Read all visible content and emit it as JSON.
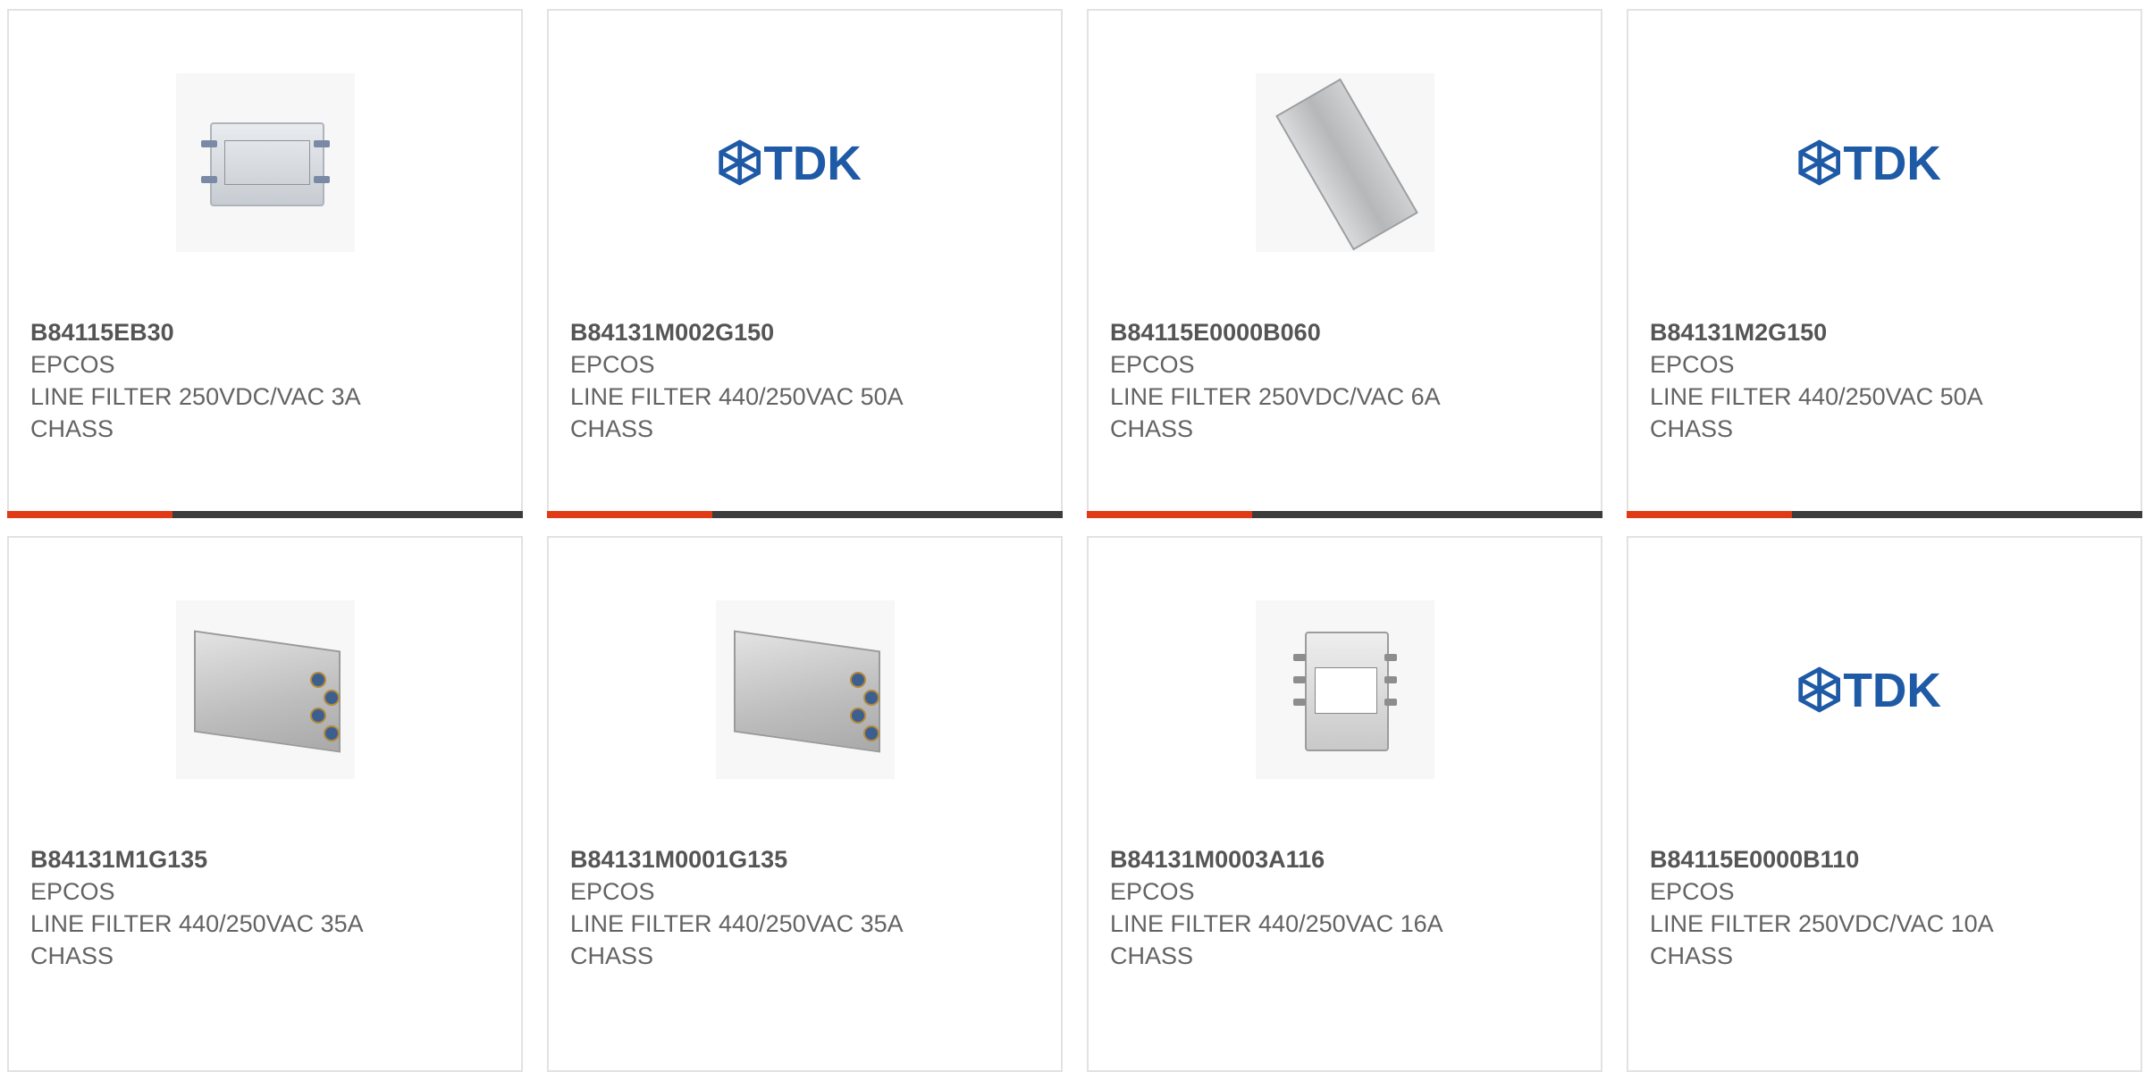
{
  "products": [
    {
      "part_number": "B84115EB30",
      "manufacturer": "EPCOS",
      "description": "LINE FILTER 250VDC/VAC 3A",
      "description2": "CHASS",
      "image": "filter-small-image",
      "progress": 0.32
    },
    {
      "part_number": "B84131M002G150",
      "manufacturer": "EPCOS",
      "description": "LINE FILTER 440/250VAC 50A",
      "description2": "CHASS",
      "image": "tdk-logo",
      "progress": 0.32
    },
    {
      "part_number": "B84115E0000B060",
      "manufacturer": "EPCOS",
      "description": "LINE FILTER 250VDC/VAC 6A",
      "description2": "CHASS",
      "image": "filter-angled-image",
      "progress": 0.32
    },
    {
      "part_number": "B84131M2G150",
      "manufacturer": "EPCOS",
      "description": "LINE FILTER 440/250VAC 50A",
      "description2": "CHASS",
      "image": "tdk-logo",
      "progress": 0.32
    },
    {
      "part_number": "B84131M1G135",
      "manufacturer": "EPCOS",
      "description": "LINE FILTER 440/250VAC 35A",
      "description2": "CHASS",
      "image": "filter-box-image",
      "progress": 0
    },
    {
      "part_number": "B84131M0001G135",
      "manufacturer": "EPCOS",
      "description": "LINE FILTER 440/250VAC 35A",
      "description2": "CHASS",
      "image": "filter-box-image",
      "progress": 0
    },
    {
      "part_number": "B84131M0003A116",
      "manufacturer": "EPCOS",
      "description": "LINE FILTER 440/250VAC 16A",
      "description2": "CHASS",
      "image": "filter-square-image",
      "progress": 0
    },
    {
      "part_number": "B84115E0000B110",
      "manufacturer": "EPCOS",
      "description": "LINE FILTER 250VDC/VAC 10A",
      "description2": "CHASS",
      "image": "tdk-logo",
      "progress": 0
    }
  ],
  "colors": {
    "progress_fill": "#e03a17",
    "progress_track": "#3c3c3c",
    "tdk_blue": "#1f5aa6",
    "border": "#e2e2e2"
  },
  "logo": {
    "text": "TDK"
  }
}
